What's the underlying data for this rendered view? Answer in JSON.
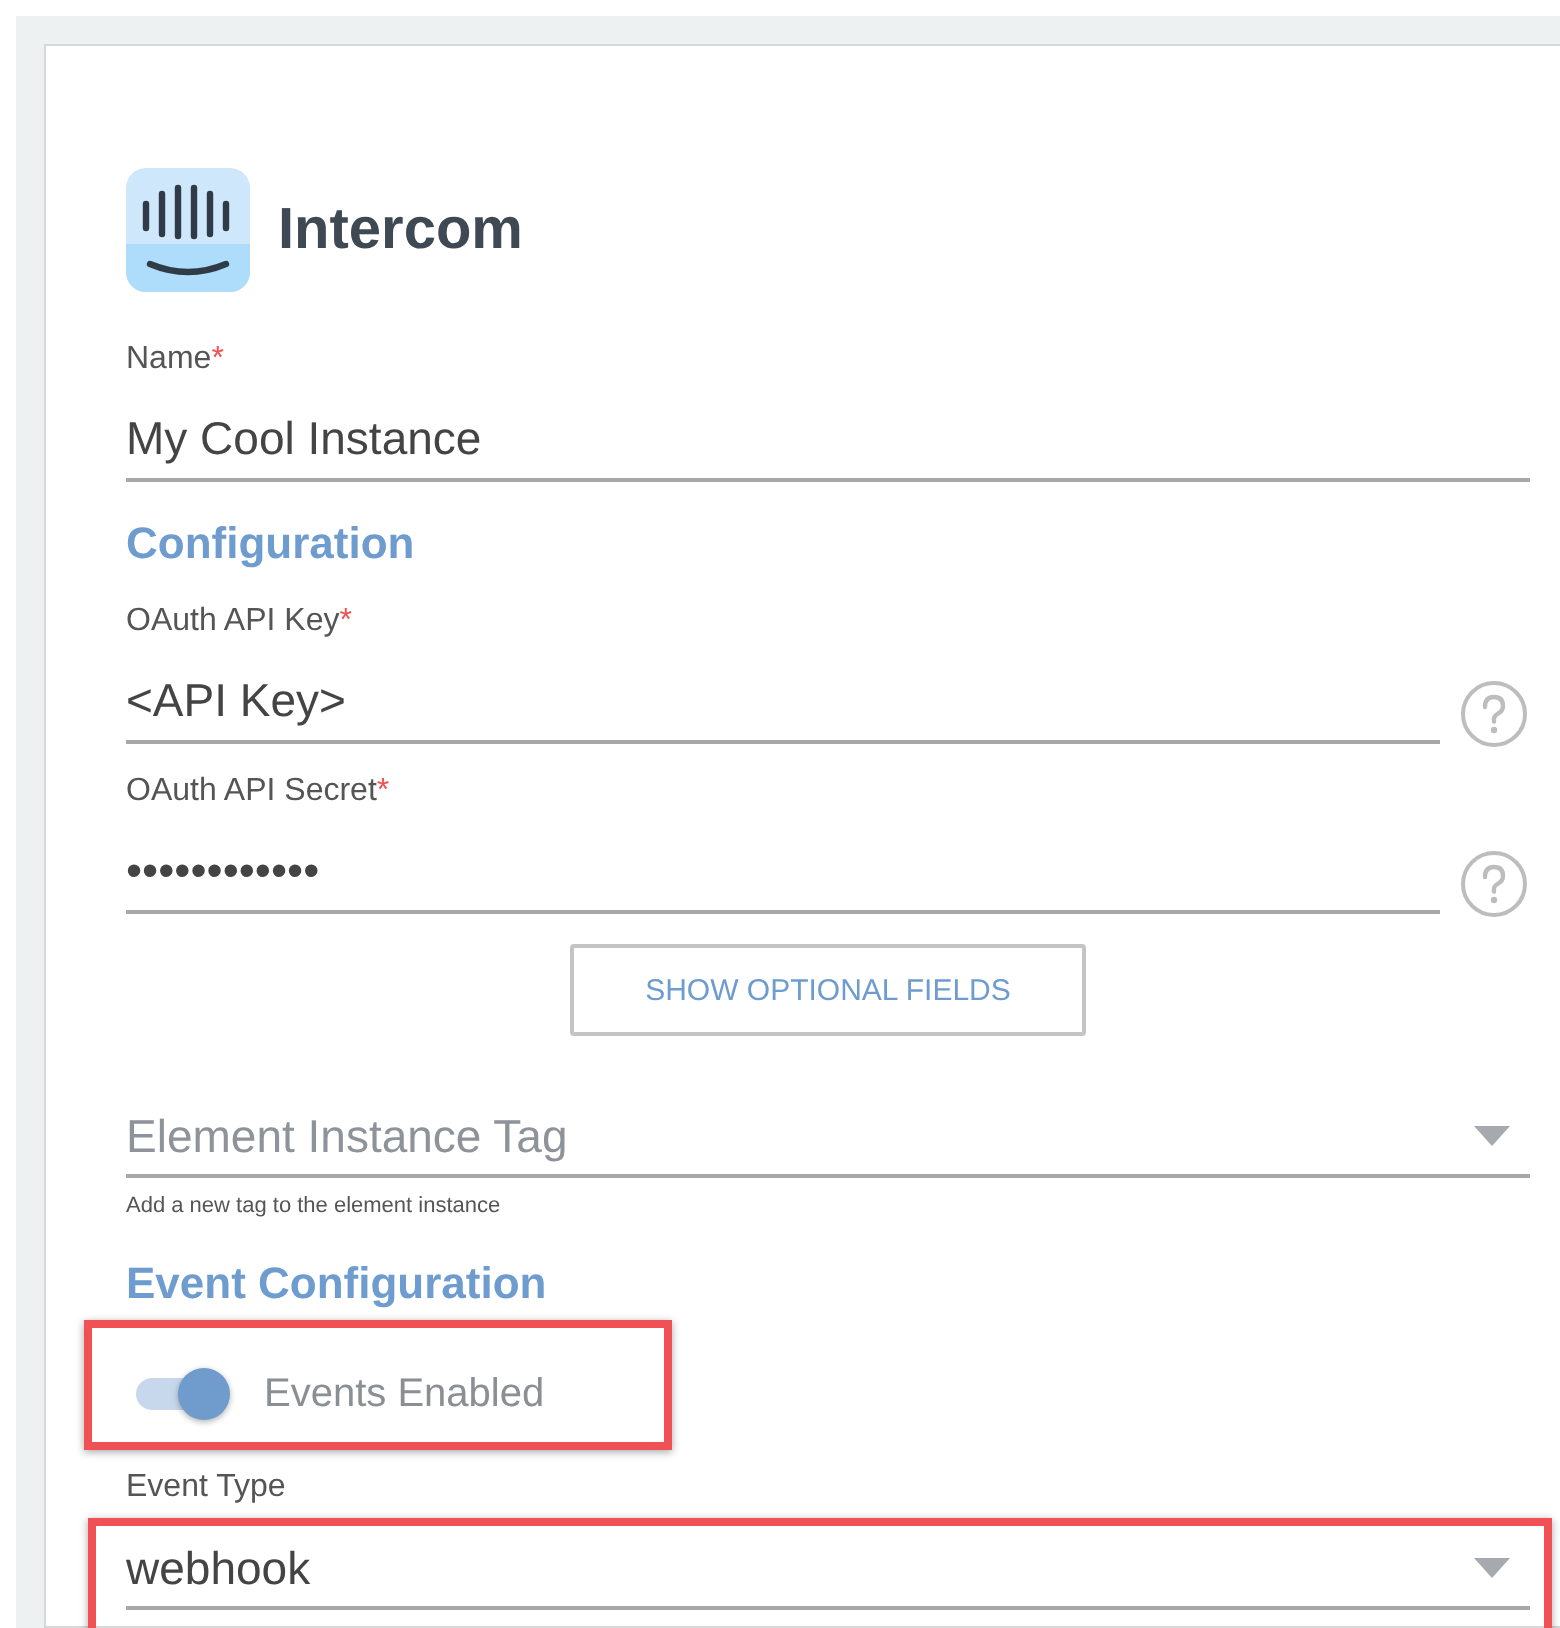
{
  "app": {
    "name": "Intercom"
  },
  "items": [
    {
      "kind": "field",
      "label": "Name",
      "required_mark": "*",
      "value": "My Cool Instance"
    },
    {
      "kind": "heading",
      "text": "Configuration"
    },
    {
      "kind": "field",
      "label": "OAuth API Key",
      "required_mark": "*",
      "value": "<API Key>",
      "help": true
    },
    {
      "kind": "field",
      "label": "OAuth API Secret",
      "required_mark": "*",
      "value": "••••••••••••",
      "help": true
    },
    {
      "kind": "button",
      "text": "SHOW OPTIONAL FIELDS"
    },
    {
      "kind": "select",
      "placeholder": "Element Instance Tag",
      "hint": "Add a new tag to the element instance"
    },
    {
      "kind": "heading",
      "text": "Event Configuration"
    },
    {
      "kind": "toggle",
      "label": "Events Enabled",
      "on": true,
      "highlighted": true
    },
    {
      "kind": "select",
      "label": "Event Type",
      "value": "webhook",
      "highlighted": true
    }
  ]
}
